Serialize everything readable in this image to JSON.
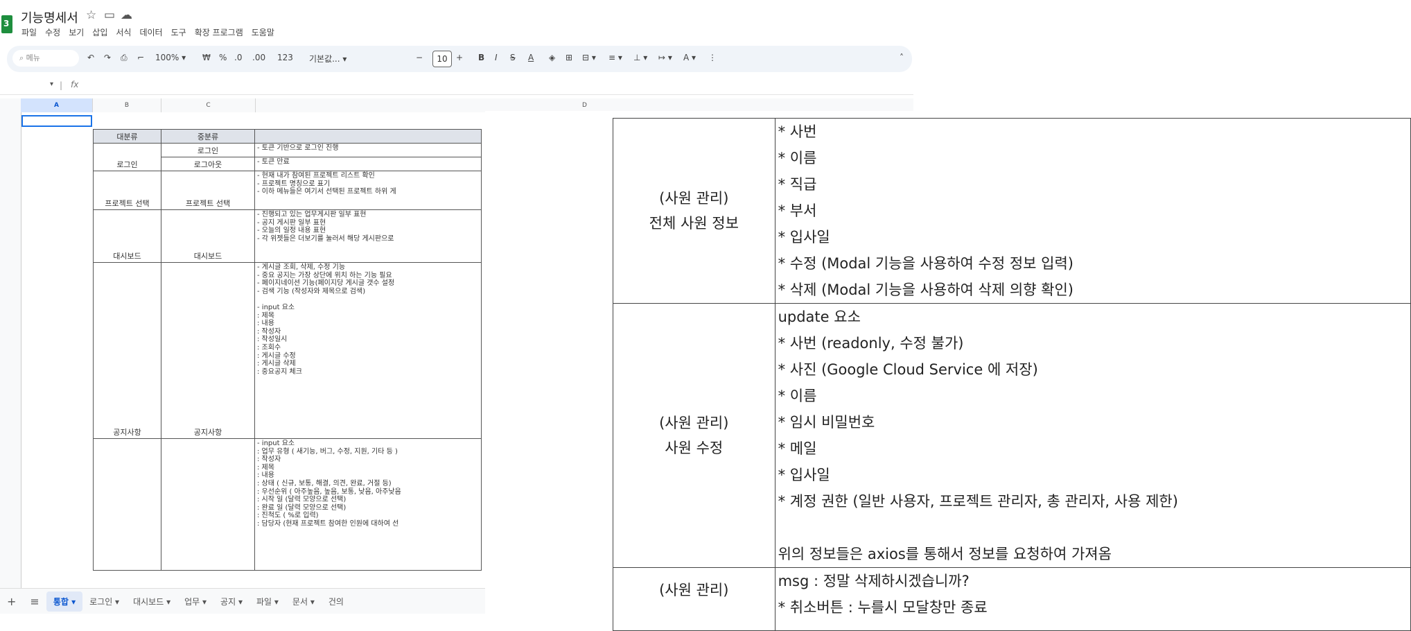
{
  "doc": {
    "app_icon_letter": "3",
    "title": "기능명세서",
    "menu": [
      "파일",
      "수정",
      "보기",
      "삽입",
      "서식",
      "데이터",
      "도구",
      "확장 프로그램",
      "도움말"
    ]
  },
  "toolbar": {
    "search_placeholder": "메뉴",
    "zoom": "100%",
    "currency": "₩",
    "percent": "%",
    "decimal_decrease": ".0",
    "decimal_increase": ".00",
    "number_format": "123",
    "font": "기본값...",
    "font_size": "10",
    "bold": "B",
    "italic": "I",
    "strike": "S",
    "text_color": "A"
  },
  "formula": {
    "fx": "fx"
  },
  "columns": [
    "A",
    "B",
    "C",
    "D"
  ],
  "table": {
    "headers": [
      "대분류",
      "중분류",
      ""
    ],
    "rows": [
      {
        "cat": "",
        "sub": "로그인",
        "desc": "- 토큰 기반으로 로그인 진행"
      },
      {
        "cat": "로그인",
        "sub": "로그아웃",
        "desc": "- 토큰 만료"
      },
      {
        "cat": "프로젝트 선택",
        "sub": "프로젝트 선택",
        "desc": "- 현재 내가 참여된 프로젝트 리스트 확인\n- 프로젝트 명칭으로 표기\n- 이하 메뉴들은 여기서 선택된 프로젝트 하위 게"
      },
      {
        "cat": "대시보드",
        "sub": "대시보드",
        "desc": "- 진행되고 있는 업무게시판 일부 표현\n- 공지 게시판 일부 표현\n- 오늘의 일정 내용 표현\n- 각 위젯들은 더보기를 눌러서 해당 게시판으로 "
      },
      {
        "cat": "공지사항",
        "sub": "공지사항",
        "desc": "- 게시글 조회, 삭제, 수정 기능\n- 중요 공지는 가장 상단에 위치 하는 기능 필요\n- 페이지네이션 기능(페이지당 게시글 갯수 설정\n- 검색 기능 (작성자와 제목으로 검색)\n\n- input 요소\n: 제목\n: 내용\n: 작성자\n: 작성일시\n: 조회수\n: 게시글 수정\n: 게시글 삭제\n: 중요공지 체크"
      },
      {
        "cat": "",
        "sub": "",
        "desc": "- input 요소\n: 업무 유형 ( 새기능, 버그, 수정, 지원, 기타 등 )\n: 작성자\n: 제목\n: 내용\n: 상태 ( 신규, 보통, 해결, 의견, 완료, 거절 등)\n: 우선순위 ( 아주높음, 높음, 보통, 낮음, 아주낮음\n: 시작 일 (달력 모양으로 선택)\n: 완료 일 (달력 모양으로 선택)\n: 진척도 ( %로 입력)\n: 담당자 (현재 프로젝트 참여한 인원에 대하여 선"
      }
    ]
  },
  "sheet_tabs": [
    "통합",
    "로그인",
    "대시보드",
    "업무",
    "공지",
    "파일",
    "문서",
    "건의"
  ],
  "zoom_table": [
    {
      "cat": [
        "(사원 관리)",
        "전체 사원 정보"
      ],
      "lines": [
        "* 사번",
        "* 이름",
        "* 직급",
        "* 부서",
        "* 입사일",
        "* 수정 (Modal 기능을 사용하여 수정 정보 입력)",
        "* 삭제 (Modal 기능을 사용하여 삭제 의향 확인)"
      ]
    },
    {
      "cat": [
        "(사원 관리)",
        "사원 수정"
      ],
      "lines": [
        "update 요소",
        "* 사번 (readonly, 수정 불가)",
        "* 사진 (Google Cloud Service 에 저장)",
        "* 이름",
        "* 임시 비밀번호",
        "* 메일",
        "* 입사일",
        "* 계정 권한 (일반 사용자, 프로젝트 관리자, 총 관리자, 사용 제한)",
        "",
        "위의 정보들은 axios를 통해서 정보를 요청하여 가져옴"
      ]
    },
    {
      "cat": [
        "(사원 관리)",
        ""
      ],
      "lines": [
        "msg : 정말 삭제하시겠습니까?",
        "* 취소버튼 : 누를시 모달창만 종료"
      ]
    }
  ]
}
